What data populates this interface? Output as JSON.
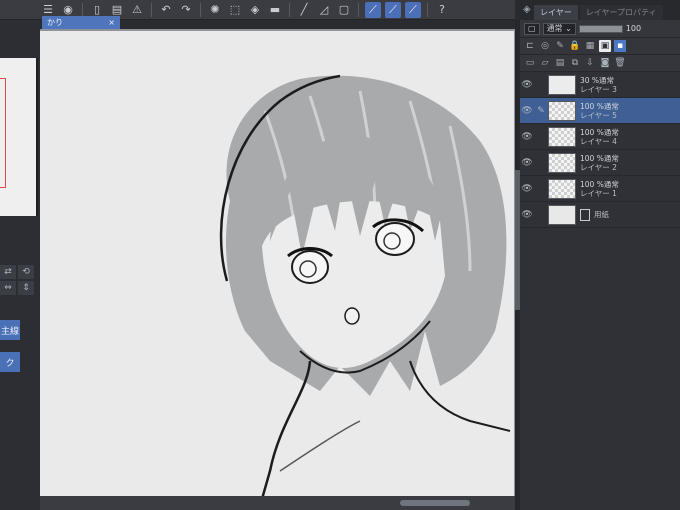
{
  "toolbar": {
    "icons": [
      "menu-icon",
      "eye-icon",
      "file-icon",
      "save-icon",
      "warning-icon",
      "undo-icon",
      "redo-icon",
      "brush-settings-icon",
      "fill-icon",
      "snap-icon",
      "ruler-icon",
      "help-icon"
    ]
  },
  "canvas": {
    "tab_title": "かり"
  },
  "left": {
    "tab1_label": "主線",
    "tab2_label": "ク"
  },
  "layer_panel": {
    "tab_active": "レイヤー",
    "tab_inactive": "レイヤープロパティ",
    "blend_mode": "通常",
    "opacity": "100",
    "layers": [
      {
        "opacity_mode": "30 %通常",
        "name": "レイヤー 3",
        "selected": false,
        "editing": false,
        "thumb": "sketch"
      },
      {
        "opacity_mode": "100 %通常",
        "name": "レイヤー 5",
        "selected": true,
        "editing": true,
        "thumb": "transparent"
      },
      {
        "opacity_mode": "100 %通常",
        "name": "レイヤー 4",
        "selected": false,
        "editing": false,
        "thumb": "transparent"
      },
      {
        "opacity_mode": "100 %通常",
        "name": "レイヤー 2",
        "selected": false,
        "editing": false,
        "thumb": "transparent"
      },
      {
        "opacity_mode": "100 %通常",
        "name": "レイヤー 1",
        "selected": false,
        "editing": false,
        "thumb": "transparent"
      },
      {
        "opacity_mode": "",
        "name": "用紙",
        "selected": false,
        "editing": false,
        "thumb": "paper"
      }
    ]
  }
}
